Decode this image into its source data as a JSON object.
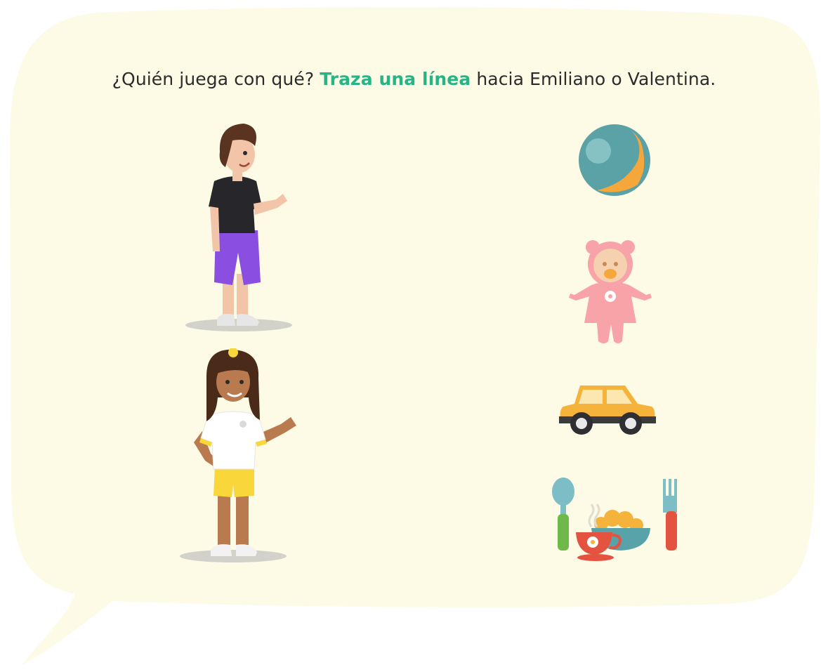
{
  "instruction": {
    "lead": "¿Quién juega con qué?",
    "highlight": "Traza una línea",
    "tail": "hacia Emiliano o Valentina."
  },
  "colors": {
    "bubble": "#fdfbe6",
    "text": "#2b2b2b",
    "accent": "#27b486"
  },
  "characters": [
    {
      "id": "boy",
      "icon": "boy-character-icon"
    },
    {
      "id": "girl",
      "icon": "girl-character-icon"
    }
  ],
  "items": [
    {
      "id": "ball",
      "icon": "ball-icon"
    },
    {
      "id": "doll",
      "icon": "baby-doll-icon"
    },
    {
      "id": "car",
      "icon": "toy-car-icon"
    },
    {
      "id": "meal",
      "icon": "meal-utensils-icon"
    }
  ]
}
